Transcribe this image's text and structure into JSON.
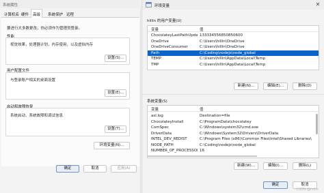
{
  "system_properties": {
    "title": "系统属性",
    "tabs": [
      {
        "label": "计算机名",
        "active": false
      },
      {
        "label": "硬件",
        "active": false
      },
      {
        "label": "高级",
        "active": true
      },
      {
        "label": "系统保护",
        "active": false
      },
      {
        "label": "远程",
        "active": false
      }
    ],
    "admin_note": "要进行大多数更改，你必须作为管理员登录。",
    "performance": {
      "title": "性能",
      "description": "视觉效果，处理器计划，内存使用，以及虚拟内存",
      "settings_label": "设置(S)..."
    },
    "user_profiles": {
      "title": "用户配置文件",
      "description": "与登录账户相关的桌面设置",
      "settings_label": "设置(E)..."
    },
    "startup_recovery": {
      "title": "启动和故障恢复",
      "description": "系统启动、系统故障和调试信息",
      "settings_label": "设置(T)..."
    },
    "env_vars_label": "环境变量(N)...",
    "ok_label": "确定",
    "cancel_label": "取消",
    "apply_label": "应用(A)"
  },
  "env_window": {
    "title": "环境变量",
    "close_icon": "close-x-icon",
    "user_section_label": "hillin 的用户变量(U)",
    "user_columns": {
      "name": "变量",
      "value": "值"
    },
    "user_vars": [
      {
        "name": "ChocolateyLastPathUpdate",
        "value": "133334556850850600",
        "selected": false
      },
      {
        "name": "OneDrive",
        "value": "C:\\Users\\hillin\\OneDrive",
        "selected": false
      },
      {
        "name": "OneDriveConsumer",
        "value": "C:\\Users\\hillin\\OneDrive",
        "selected": false
      },
      {
        "name": "Path",
        "value": "C:\\Coding\\nodejs\\node_global",
        "selected": true
      },
      {
        "name": "TEMP",
        "value": "C:\\Users\\hillin\\AppData\\Local\\Temp",
        "selected": false
      },
      {
        "name": "TMP",
        "value": "C:\\Users\\hillin\\AppData\\Local\\Temp",
        "selected": false
      }
    ],
    "user_buttons": {
      "new": "新建(N)...",
      "edit": "编辑(E)...",
      "delete": "删除(D)"
    },
    "system_section_label": "系统变量(S)",
    "system_columns": {
      "name": "变量",
      "value": "值"
    },
    "system_vars": [
      {
        "name": "asl.log",
        "value": "Destination=file"
      },
      {
        "name": "ChocolateyInstall",
        "value": "C:\\ProgramData\\chocolatey"
      },
      {
        "name": "ComSpec",
        "value": "C:\\Windows\\system32\\cmd.exe"
      },
      {
        "name": "DriverData",
        "value": "C:\\Windows\\System32\\Drivers\\DriverData"
      },
      {
        "name": "INTEL_DEV_REDIST",
        "value": "C:\\Program Files (x86)\\Common Files\\Intel\\Shared Libraries\\"
      },
      {
        "name": "NODE_PATH",
        "value": "C:\\Coding\\nodejs\\node_global"
      },
      {
        "name": "NUMBER_OF_PROCESSORS",
        "value": "16"
      }
    ],
    "system_buttons": {
      "new": "新建(W)...",
      "edit": "编辑(I)...",
      "delete": "删除(L)"
    },
    "ok_label": "确定",
    "cancel_label": "取消"
  },
  "watermark": "CSDN @hillin"
}
